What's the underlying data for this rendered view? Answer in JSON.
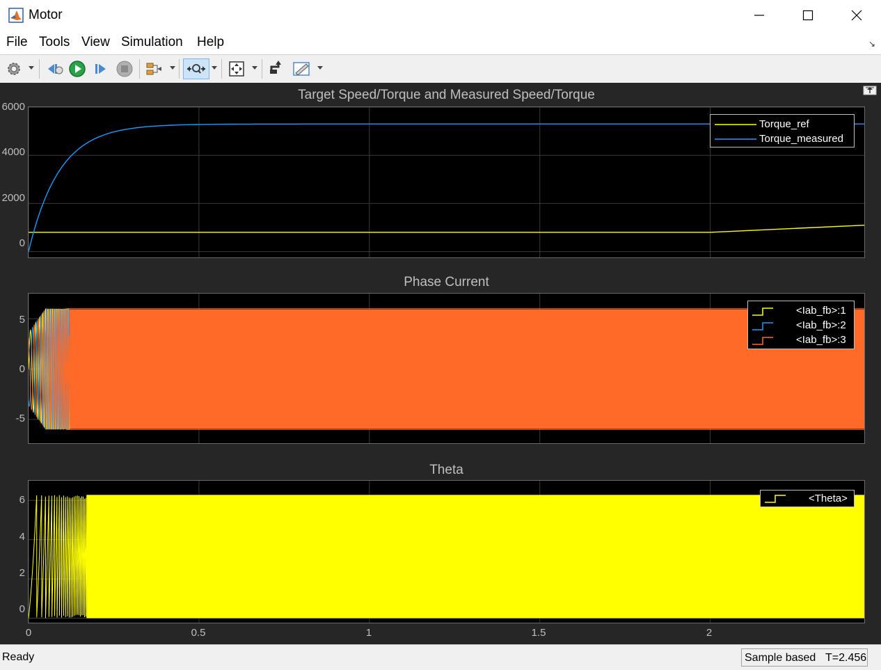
{
  "window": {
    "title": "Motor",
    "icon": "matlab-logo-icon",
    "controls": [
      "minimize-icon",
      "maximize-icon",
      "close-icon"
    ]
  },
  "menu": {
    "items": [
      "File",
      "Tools",
      "View",
      "Simulation",
      "Help"
    ]
  },
  "toolbar": {
    "icons": [
      "settings-gear-icon",
      "step-back-icon",
      "run-icon",
      "step-forward-icon",
      "stop-icon",
      "signal-selector-icon",
      "zoom-icon",
      "fit-view-icon",
      "highlight-simulink-icon",
      "style-icon"
    ]
  },
  "plots": [
    {
      "title": "Target Speed/Torque and Measured Speed/Torque",
      "yticks": [
        "6000",
        "4000",
        "2000",
        "0"
      ],
      "legend": [
        "Torque_ref",
        "Torque_measured"
      ]
    },
    {
      "title": "Phase Current",
      "yticks": [
        "5",
        "0",
        "-5"
      ],
      "legend": [
        "<Iab_fb>:1",
        "<Iab_fb>:2",
        "<Iab_fb>:3"
      ]
    },
    {
      "title": "Theta",
      "yticks": [
        "6",
        "4",
        "2",
        "0"
      ],
      "legend": [
        "<Theta>"
      ]
    }
  ],
  "xaxis": {
    "ticks": [
      "0",
      "0.5",
      "1",
      "1.5",
      "2"
    ]
  },
  "status": {
    "state": "Ready",
    "mode": "Sample based",
    "time": "T=2.456"
  },
  "colors": {
    "scope_bg": "#262626",
    "axes_bg": "#000000",
    "torque_ref": "#ffff00",
    "torque_measured": "#1a9cff",
    "phase1": "#ffff00",
    "phase2": "#1a9cff",
    "phase3": "#ff6a27",
    "theta": "#ffff00"
  },
  "chart_data": [
    {
      "type": "line",
      "title": "Target Speed/Torque and Measured Speed/Torque",
      "xlim": [
        0,
        2.456
      ],
      "ylim": [
        -300,
        6000
      ],
      "grid": true,
      "legend_position": "top-right",
      "series": [
        {
          "name": "Torque_ref",
          "x": [
            0,
            2.0,
            2.456
          ],
          "y": [
            800,
            800,
            1100
          ]
        },
        {
          "name": "Torque_measured",
          "x": [
            0,
            0.05,
            0.1,
            0.15,
            0.2,
            0.3,
            0.4,
            0.5,
            0.7,
            1.0,
            2.456
          ],
          "y": [
            0,
            1800,
            3000,
            3800,
            4300,
            4900,
            5150,
            5250,
            5300,
            5300,
            5300
          ]
        }
      ]
    },
    {
      "type": "line",
      "title": "Phase Current",
      "xlim": [
        0,
        2.456
      ],
      "ylim": [
        -7.5,
        7.5
      ],
      "grid": true,
      "legend_position": "top-right",
      "series": [
        {
          "name": "<Iab_fb>:1",
          "amplitude": 6
        },
        {
          "name": "<Iab_fb>:2",
          "amplitude": 6
        },
        {
          "name": "<Iab_fb>:3",
          "amplitude": 6
        }
      ]
    },
    {
      "type": "line",
      "title": "Theta",
      "xlim": [
        0,
        2.456
      ],
      "ylim": [
        -0.3,
        7
      ],
      "grid": true,
      "legend_position": "top-right",
      "series": [
        {
          "name": "<Theta>",
          "min": 0,
          "max": 6.28
        }
      ]
    }
  ]
}
